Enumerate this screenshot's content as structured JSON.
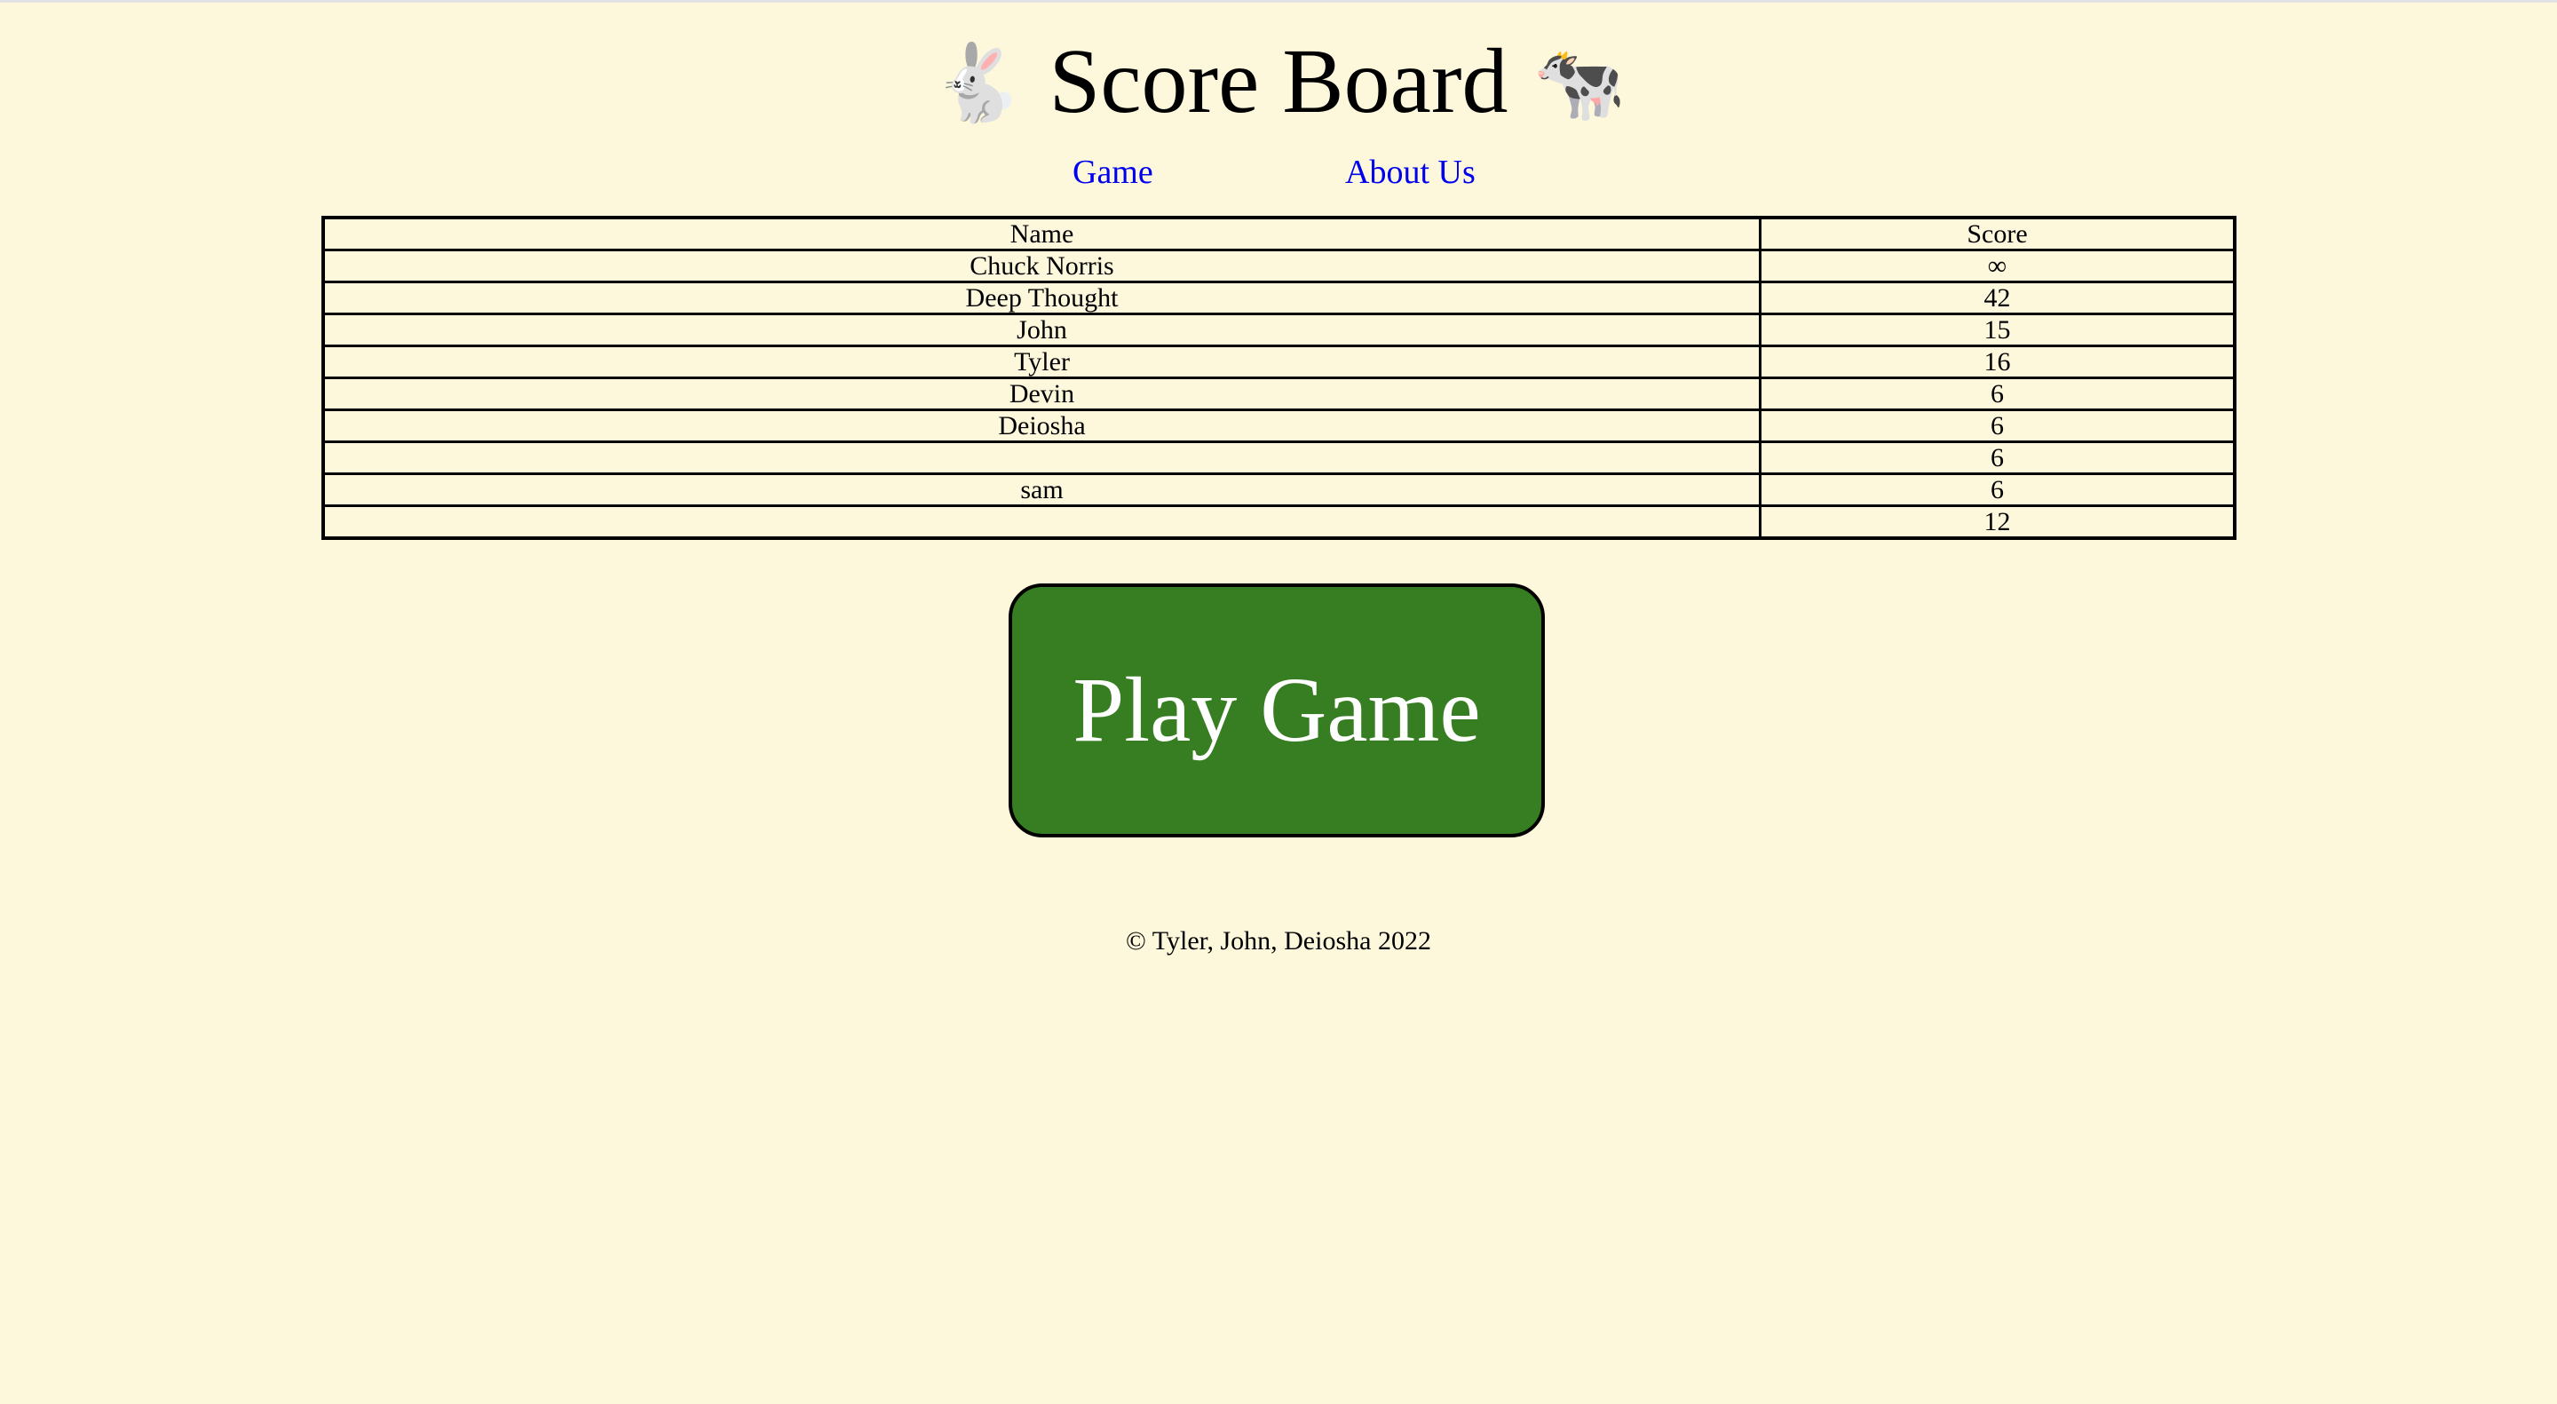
{
  "header": {
    "title": "Score Board",
    "left_icon": "rabbit-icon",
    "left_glyph": "🐇",
    "right_icon": "cow-icon",
    "right_glyph": "🐄"
  },
  "nav": {
    "items": [
      {
        "label": "Game"
      },
      {
        "label": "About Us"
      }
    ],
    "link_color": "#0000ee"
  },
  "scoreboard": {
    "columns": [
      "Name",
      "Score"
    ],
    "rows": [
      {
        "name": "Chuck Norris",
        "score": "∞"
      },
      {
        "name": "Deep Thought",
        "score": "42"
      },
      {
        "name": "John",
        "score": "15"
      },
      {
        "name": "Tyler",
        "score": "16"
      },
      {
        "name": "Devin",
        "score": "6"
      },
      {
        "name": "Deiosha",
        "score": "6"
      },
      {
        "name": "",
        "score": "6"
      },
      {
        "name": "sam",
        "score": "6"
      },
      {
        "name": "",
        "score": "12"
      }
    ]
  },
  "play_button": {
    "label": "Play Game",
    "color": "#377e22"
  },
  "footer": {
    "text": "© Tyler, John, Deiosha 2022"
  },
  "colors": {
    "background": "#fdf7dc"
  }
}
